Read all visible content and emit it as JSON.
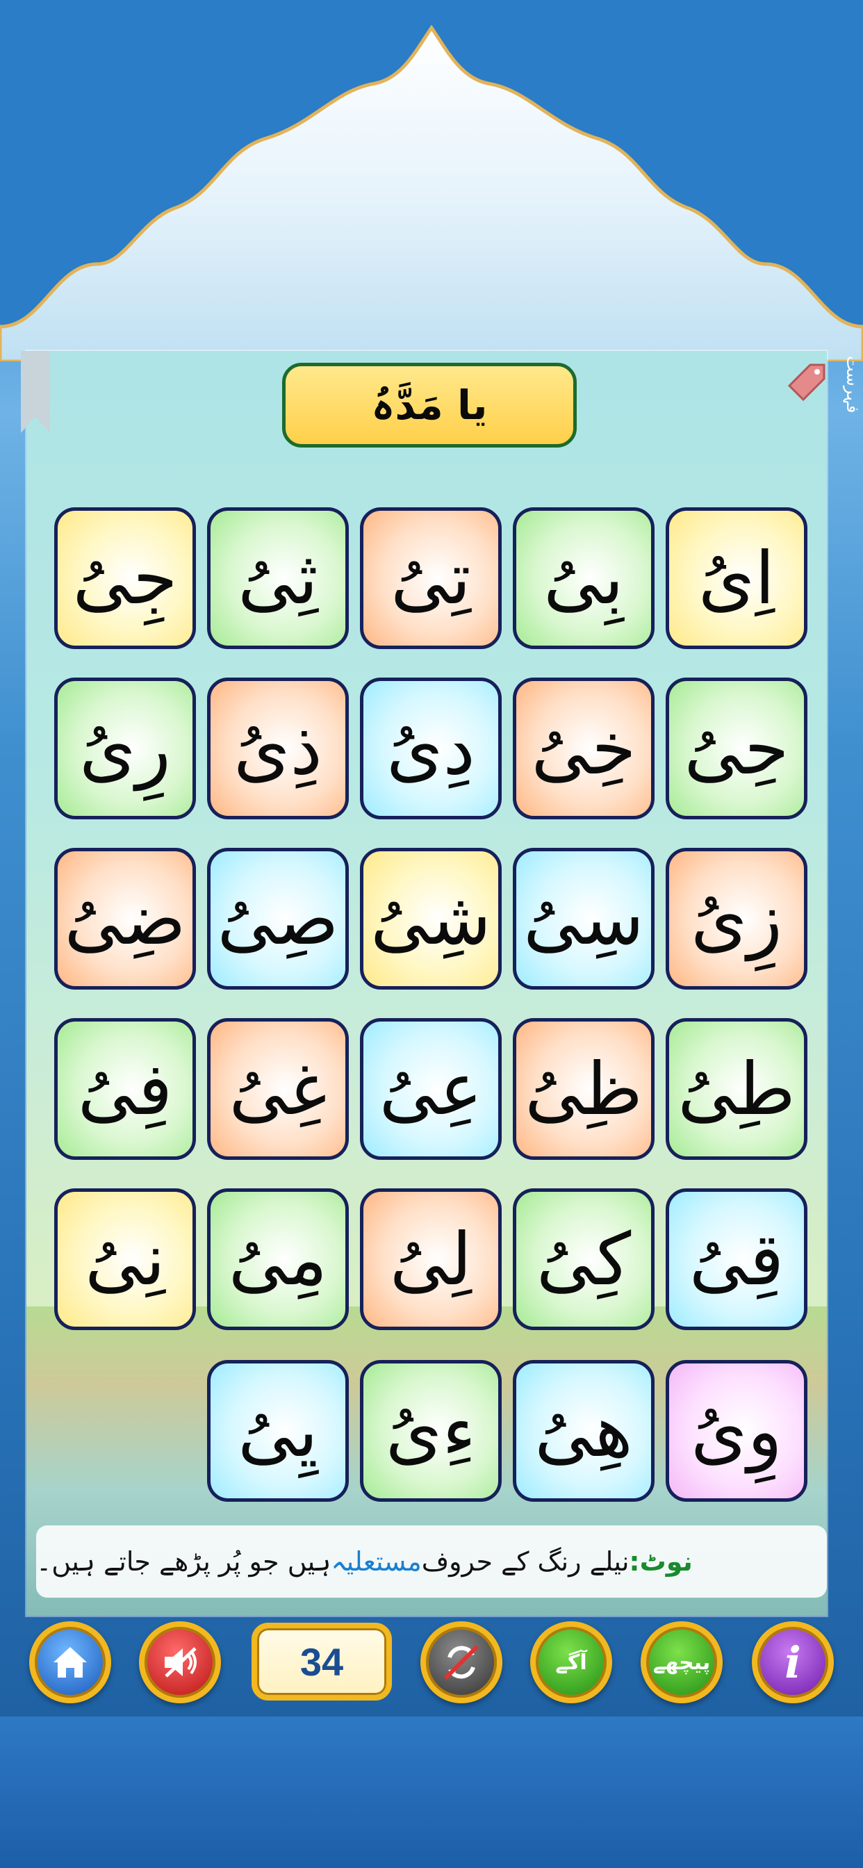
{
  "title": "یا مَدَّہُ",
  "side_label": "فہرست",
  "letters": [
    [
      "اِیُ",
      "بِیُ",
      "تِیُ",
      "ثِیُ",
      "جِیُ"
    ],
    [
      "حِیُ",
      "خِیُ",
      "دِیُ",
      "ذِیُ",
      "رِیُ"
    ],
    [
      "زِیُ",
      "سِیُ",
      "شِیُ",
      "صِیُ",
      "ضِیُ"
    ],
    [
      "طِیُ",
      "ظِیُ",
      "عِیُ",
      "غِیُ",
      "فِیُ"
    ],
    [
      "قِیُ",
      "کِیُ",
      "لِیُ",
      "مِیُ",
      "نِیُ"
    ],
    [
      "وِیُ",
      "ھِیُ",
      "ءِیُ",
      "یِیُ"
    ]
  ],
  "note": {
    "label": "نوٹ:",
    "text_before": " نیلے رنگ کے حروف ",
    "highlight": "مستعلیہ",
    "text_after": " ہیں جو پُر پڑھے جاتے ہیں۔"
  },
  "toolbar": {
    "page_number": "34",
    "next_label": "آگے",
    "prev_label": "پیچھے",
    "info_label": "i",
    "icons": [
      "home-icon",
      "mute-icon",
      "repeat-off-icon",
      "info-icon"
    ]
  },
  "colors": {
    "title_border": "#1d6b2d",
    "harakat": "#12a33c",
    "tile_border": "#16205a",
    "button_ring": "#f2b81f"
  }
}
